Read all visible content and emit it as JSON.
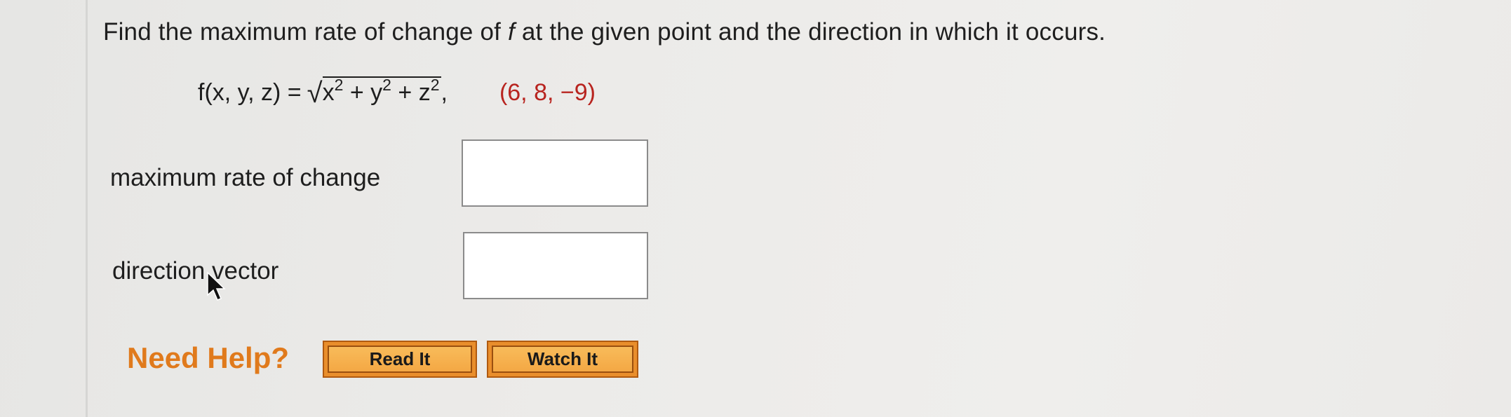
{
  "question": {
    "before": "Find the maximum rate of change of ",
    "var": "f",
    "after": " at the given point and the direction in which it occurs."
  },
  "formula": {
    "lhs": "f(x, y, z) = ",
    "radicand_parts": [
      "x",
      "2",
      " + y",
      "2",
      " + z",
      "2"
    ],
    "trailing": ",",
    "point": "(6, 8, −9)"
  },
  "fields": {
    "max_rate_label": "maximum rate of change",
    "max_rate_value": "",
    "direction_label": "direction vector",
    "direction_value": ""
  },
  "help": {
    "title": "Need Help?",
    "read_it": "Read It",
    "watch_it": "Watch It"
  },
  "colors": {
    "point": "#b8241f",
    "need_help": "#e07a1c",
    "button": "#f4a844"
  }
}
